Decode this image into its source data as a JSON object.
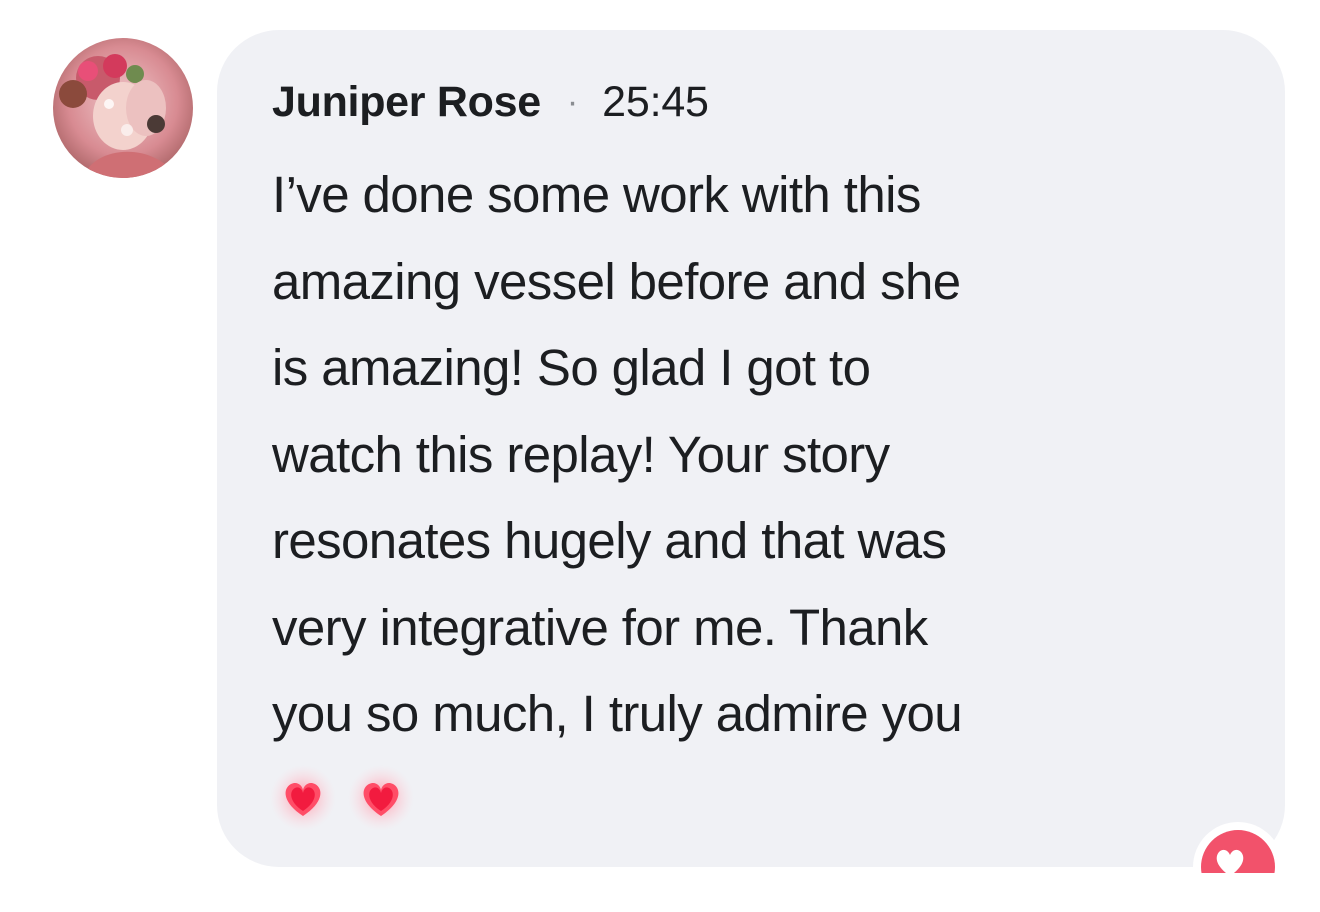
{
  "comment": {
    "author": "Juniper Rose",
    "separator": "·",
    "timestamp": "25:45",
    "text_lines": [
      "I’ve done some work with this",
      "amazing vessel before and she",
      "is amazing! So glad I got to",
      "watch this replay! Your story",
      "resonates hugely and that was",
      "very integrative for me. Thank",
      "you so much, I truly admire you"
    ],
    "emojis": [
      "heart-emoji",
      "heart-emoji"
    ],
    "reaction": {
      "icon": "heart-reaction-icon"
    }
  },
  "colors": {
    "bubble_background": "#f0f1f5",
    "text": "#1c1e21",
    "separator": "#8a8d91",
    "reaction": "#f2526b"
  }
}
